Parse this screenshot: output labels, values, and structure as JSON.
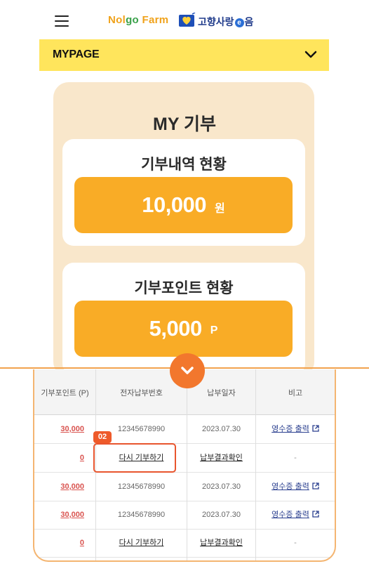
{
  "header": {
    "logo_nolgo_1": "Nol",
    "logo_nolgo_g": "go",
    "logo_nolgo_farm": " Farm",
    "logo_gh": "고향사랑",
    "logo_gh_e": "e",
    "logo_gh_end": "음"
  },
  "mypage": {
    "label": "MYPAGE"
  },
  "my_donation": {
    "title": "MY 기부",
    "history": {
      "title": "기부내역 현황",
      "amount": "10,000",
      "unit": "원"
    },
    "points": {
      "title": "기부포인트 현황",
      "amount": "5,000",
      "unit": "P"
    }
  },
  "table": {
    "columns": [
      "기부포인트 (P)",
      "전자납부번호",
      "납부일자",
      "비고"
    ],
    "rows": [
      {
        "points": "30,000",
        "number": "12345678990",
        "date": "2023.07.30",
        "note": "영수증 출력"
      },
      {
        "points": "0",
        "number": "다시 기부하기",
        "date": "납부결과확인",
        "note": "-"
      },
      {
        "points": "30,000",
        "number": "12345678990",
        "date": "2023.07.30",
        "note": "영수증 출력"
      },
      {
        "points": "30,000",
        "number": "12345678990",
        "date": "2023.07.30",
        "note": "영수증 출력"
      },
      {
        "points": "0",
        "number": "다시 기부하기",
        "date": "납부결과확인",
        "note": "-"
      }
    ],
    "badge": "02"
  },
  "colors": {
    "accent_yellow": "#ffe55c",
    "amount_orange": "#f9ac26",
    "card_bg": "#f9e7cb",
    "highlight": "#e8552e"
  }
}
